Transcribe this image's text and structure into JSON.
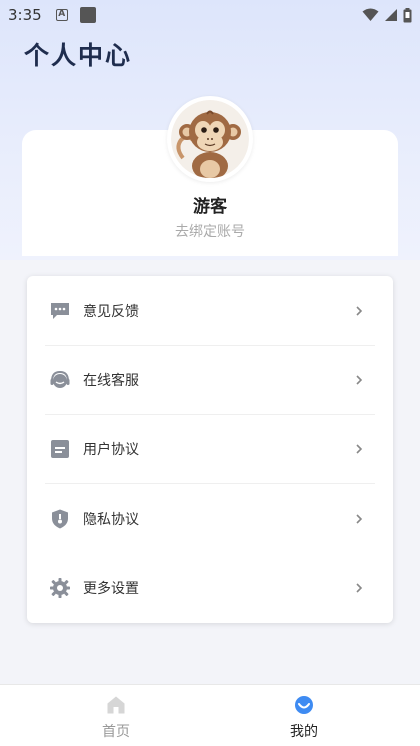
{
  "status_bar": {
    "time": "3:35",
    "notification_a": "A"
  },
  "page_title": "个人中心",
  "profile": {
    "username": "游客",
    "bind_account": "去绑定账号"
  },
  "menu": [
    {
      "label": "意见反馈",
      "icon": "feedback-icon"
    },
    {
      "label": "在线客服",
      "icon": "customer-service-icon"
    },
    {
      "label": "用户协议",
      "icon": "document-icon"
    },
    {
      "label": "隐私协议",
      "icon": "shield-icon"
    },
    {
      "label": "更多设置",
      "icon": "gear-icon"
    }
  ],
  "tabs": [
    {
      "label": "首页",
      "icon": "home-icon",
      "active": false
    },
    {
      "label": "我的",
      "icon": "profile-icon",
      "active": true
    }
  ],
  "colors": {
    "accent": "#3e8bf2",
    "inactive": "#999999"
  }
}
